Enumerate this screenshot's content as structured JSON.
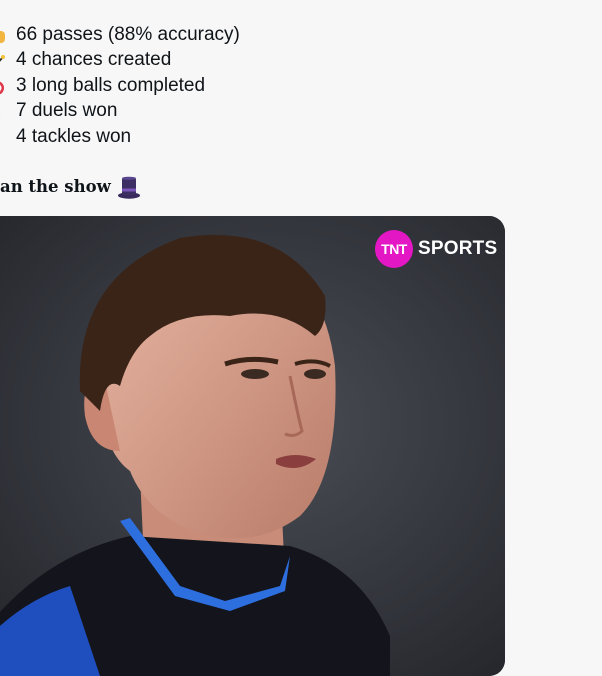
{
  "tweet": {
    "stats": [
      {
        "emoji": "soccer-pass-emoji",
        "text": "66 passes (88% accuracy)"
      },
      {
        "emoji": "magic-wand-emoji",
        "text": "4 chances created"
      },
      {
        "emoji": "target-emoji",
        "text": "3 long balls completed"
      },
      {
        "emoji": "flexed-arm-emoji",
        "text": "7 duels won"
      },
      {
        "emoji": "shield-emoji",
        "text": "4 tackles won"
      }
    ],
    "tagline": "an the show",
    "tagline_emoji": "top-hat-emoji"
  },
  "media": {
    "logo_mark": "TNT",
    "logo_word": "SPORTS",
    "brand_color": "#e317c4"
  }
}
